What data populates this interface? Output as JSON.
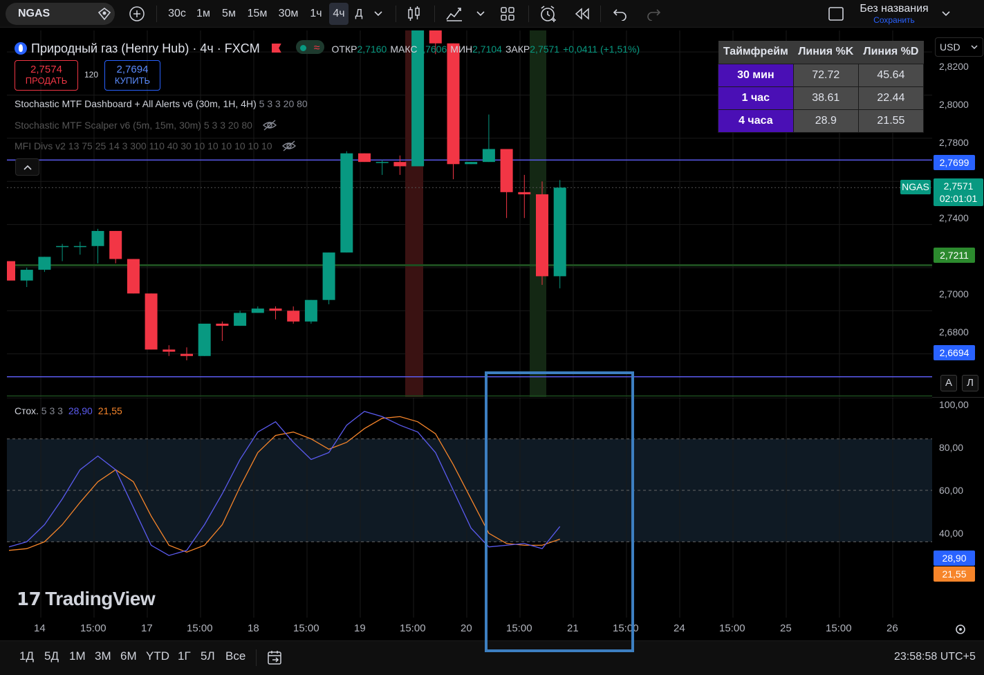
{
  "toolbar": {
    "symbol": "NGAS",
    "timeframes": [
      "30с",
      "1м",
      "5м",
      "15м",
      "30м",
      "1ч",
      "4ч",
      "Д"
    ],
    "active_timeframe": "4ч",
    "layout_title": "Без названия",
    "layout_subtitle": "Сохранить"
  },
  "legend": {
    "title": "Природный газ (Henry Hub) · 4ч · FXCM",
    "open_label": "ОТКР",
    "open": "2,7160",
    "high_label": "МАКС",
    "high": "2,7606",
    "low_label": "МИН",
    "low": "2,7104",
    "close_label": "ЗАКР",
    "close": "2,7571",
    "change": "+0,0411 (+1,51%)",
    "sell_price": "2,7574",
    "sell_label": "ПРОДАТЬ",
    "spread": "120",
    "buy_price": "2,7694",
    "buy_label": "КУПИТЬ",
    "indicator1": "Stochastic MTF Dashboard + All Alerts v6 (30m, 1H, 4H)",
    "indicator1_params": "5 3 3 20 80",
    "indicator2": "Stochastic MTF Scalper v6 (5m, 15m, 30m) 5 3 3 20 80",
    "indicator3": "MFI Divs v2 13 75 25 14 3 300 110 40 30 10 10 10 10 10 10"
  },
  "dashboard": {
    "headers": [
      "Таймфрейм",
      "Линия %K",
      "Линия %D"
    ],
    "rows": [
      {
        "tf": "30 мин",
        "k": "72.72",
        "d": "45.64"
      },
      {
        "tf": "1 час",
        "k": "38.61",
        "d": "22.44"
      },
      {
        "tf": "4 часа",
        "k": "28.9",
        "d": "21.55"
      }
    ]
  },
  "price_axis": {
    "currency": "USD",
    "labels": [
      "2,8200",
      "2,8000",
      "2,7800",
      "2,7400",
      "2,7000",
      "2,6800"
    ],
    "tag_upper": "2,7699",
    "tag_current": "2,7571",
    "tag_countdown": "02:01:01",
    "tag_symbol": "NGAS",
    "tag_green": "2,7211",
    "tag_lower": "2,6694",
    "auto_label": "А",
    "log_label": "Л"
  },
  "oscillator": {
    "name": "Стох.",
    "params": "5 3 3",
    "k_value": "28,90",
    "d_value": "21,55",
    "axis_labels": [
      "100,00",
      "80,00",
      "60,00",
      "40,00"
    ]
  },
  "x_axis": {
    "labels": [
      "14",
      "15:00",
      "17",
      "15:00",
      "18",
      "15:00",
      "19",
      "15:00",
      "20",
      "15:00",
      "21",
      "15:00",
      "24",
      "15:00",
      "25",
      "15:00",
      "26"
    ]
  },
  "bottom": {
    "ranges": [
      "1Д",
      "5Д",
      "1М",
      "3М",
      "6М",
      "YTD",
      "1Г",
      "5Л",
      "Все"
    ],
    "clock": "23:58:58 UTC+5"
  },
  "logo": "TradingView",
  "chart_data": {
    "type": "candlestick",
    "candles": [
      {
        "o": 2.723,
        "h": 2.723,
        "l": 2.714,
        "c": 2.714
      },
      {
        "o": 2.714,
        "h": 2.72,
        "l": 2.711,
        "c": 2.719
      },
      {
        "o": 2.719,
        "h": 2.725,
        "l": 2.718,
        "c": 2.725
      },
      {
        "o": 2.73,
        "h": 2.731,
        "l": 2.723,
        "c": 2.73
      },
      {
        "o": 2.73,
        "h": 2.732,
        "l": 2.726,
        "c": 2.73
      },
      {
        "o": 2.73,
        "h": 2.738,
        "l": 2.722,
        "c": 2.737
      },
      {
        "o": 2.737,
        "h": 2.737,
        "l": 2.722,
        "c": 2.724
      },
      {
        "o": 2.724,
        "h": 2.724,
        "l": 2.708,
        "c": 2.708
      },
      {
        "o": 2.708,
        "h": 2.708,
        "l": 2.682,
        "c": 2.682
      },
      {
        "o": 2.682,
        "h": 2.684,
        "l": 2.679,
        "c": 2.681
      },
      {
        "o": 2.68,
        "h": 2.683,
        "l": 2.677,
        "c": 2.679
      },
      {
        "o": 2.679,
        "h": 2.694,
        "l": 2.679,
        "c": 2.694
      },
      {
        "o": 2.694,
        "h": 2.695,
        "l": 2.686,
        "c": 2.693
      },
      {
        "o": 2.693,
        "h": 2.7,
        "l": 2.693,
        "c": 2.699
      },
      {
        "o": 2.699,
        "h": 2.702,
        "l": 2.699,
        "c": 2.701
      },
      {
        "o": 2.701,
        "h": 2.702,
        "l": 2.696,
        "c": 2.7
      },
      {
        "o": 2.7,
        "h": 2.702,
        "l": 2.694,
        "c": 2.695
      },
      {
        "o": 2.695,
        "h": 2.705,
        "l": 2.694,
        "c": 2.705
      },
      {
        "o": 2.705,
        "h": 2.727,
        "l": 2.703,
        "c": 2.727
      },
      {
        "o": 2.727,
        "h": 2.774,
        "l": 2.727,
        "c": 2.773
      },
      {
        "o": 2.773,
        "h": 2.773,
        "l": 2.769,
        "c": 2.769
      },
      {
        "o": 2.769,
        "h": 2.77,
        "l": 2.763,
        "c": 2.769
      },
      {
        "o": 2.769,
        "h": 2.772,
        "l": 2.763,
        "c": 2.767
      },
      {
        "o": 2.767,
        "h": 2.83,
        "l": 2.767,
        "c": 2.83
      },
      {
        "o": 2.83,
        "h": 2.83,
        "l": 2.819,
        "c": 2.824
      },
      {
        "o": 2.824,
        "h": 2.824,
        "l": 2.761,
        "c": 2.768
      },
      {
        "o": 2.768,
        "h": 2.769,
        "l": 2.768,
        "c": 2.769
      },
      {
        "o": 2.769,
        "h": 2.791,
        "l": 2.769,
        "c": 2.775
      },
      {
        "o": 2.775,
        "h": 2.774,
        "l": 2.743,
        "c": 2.755
      },
      {
        "o": 2.755,
        "h": 2.763,
        "l": 2.743,
        "c": 2.754
      },
      {
        "o": 2.754,
        "h": 2.76,
        "l": 2.712,
        "c": 2.716
      },
      {
        "o": 2.716,
        "h": 2.7606,
        "l": 2.7104,
        "c": 2.7571
      }
    ],
    "price_range": [
      2.66,
      2.83
    ],
    "stoch_k": [
      17,
      20,
      30,
      45,
      62,
      70,
      62,
      40,
      18,
      12,
      15,
      30,
      48,
      68,
      84,
      90,
      78,
      68,
      72,
      88,
      96,
      93,
      88,
      84,
      72,
      50,
      28,
      17,
      18,
      19,
      16,
      28.9
    ],
    "stoch_d": [
      15,
      16,
      20,
      30,
      43,
      55,
      62,
      55,
      35,
      18,
      14,
      18,
      30,
      52,
      72,
      82,
      84,
      80,
      74,
      78,
      86,
      92,
      93,
      90,
      83,
      65,
      45,
      25,
      19,
      18,
      18,
      21.55
    ],
    "stoch_range": [
      0,
      100
    ],
    "stoch_levels": [
      80,
      50,
      20
    ]
  }
}
